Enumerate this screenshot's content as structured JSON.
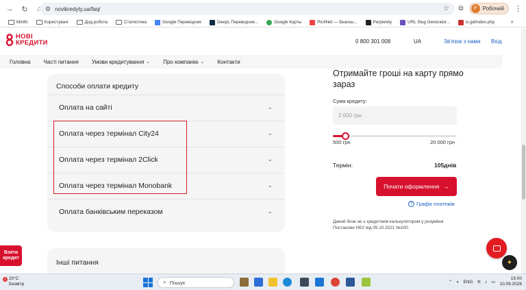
{
  "browser": {
    "url": "novikredyty.ua/faq/",
    "profile_label": "Робочий",
    "profile_initial": "Р",
    "bookmarks": [
      "Minfin",
      "Користувачі",
      "Дод.робота",
      "Статистика",
      "Google Переводчик",
      "DeepL Переводчик...",
      "Google Карты",
      "Pic4Net — безкош...",
      "Perplexity",
      "URL Slug Generator...",
      "is.gd/index.php"
    ]
  },
  "site": {
    "logo_line1": "НОВІ",
    "logo_line2": "КРЕДИТИ",
    "phone": "0 800 301 008",
    "lang": "UA",
    "contact": "Зв'язок з нами",
    "login": "Вхід",
    "brand_color": "#d7102e"
  },
  "nav": {
    "items": [
      "Головна",
      "Часті питання",
      "Умови кредитування",
      "Про компанію",
      "Контакти"
    ]
  },
  "payment": {
    "title": "Способи оплати кредиту",
    "options": [
      "Оплата на сайті",
      "Оплата через термінал City24",
      "Оплата через термінал 2Click",
      "Оплата через термінал Monobank",
      "Оплата банківським переказом"
    ]
  },
  "faq_next": "Інші питання",
  "calculator": {
    "title": "Отримайте гроші на карту прямо зараз",
    "sum_label": "Сума кредиту:",
    "sum_placeholder": "2 000 грн",
    "slider_min": "500 грн",
    "slider_max": "20 000 грн",
    "slider_fraction": 0.1,
    "term_label": "Термін:",
    "term_value": "105днів",
    "apply_label": "Почати оформлення",
    "schedule_label": "Графік платежів",
    "disclaimer": "Даний блок не є кредитним калькулятором у розумінні Постанови НБУ від 05.10.2021 №100."
  },
  "floating": {
    "take_credit_line1": "Взяти",
    "take_credit_line2": "кредит"
  },
  "taskbar": {
    "temp": "20°C",
    "weather": "Безвітр",
    "search": "Пошук",
    "lang": "ENG",
    "time": "15:00",
    "date": "10.09.2026"
  }
}
